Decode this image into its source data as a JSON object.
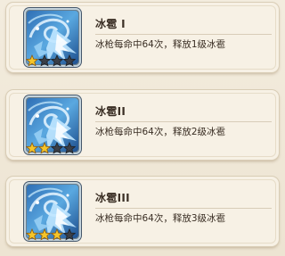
{
  "skills": [
    {
      "name": "冰雹 I",
      "description": "冰枪每命中64次，释放1级冰雹",
      "stars_filled": 1,
      "stars_total": 4,
      "icon": "ice-hail-skill-icon"
    },
    {
      "name": "冰雹II",
      "description": "冰枪每命中64次，释放2级冰雹",
      "stars_filled": 2,
      "stars_total": 4,
      "icon": "ice-hail-skill-icon"
    },
    {
      "name": "冰雹III",
      "description": "冰枪每命中64次，释放3级冰雹",
      "stars_filled": 3,
      "stars_total": 4,
      "icon": "ice-hail-skill-icon"
    }
  ],
  "colors": {
    "star_filled": "#f5c52a",
    "star_empty": "#3a3f47",
    "card_bg": "#f7f1e5",
    "text": "#3b2f25"
  }
}
